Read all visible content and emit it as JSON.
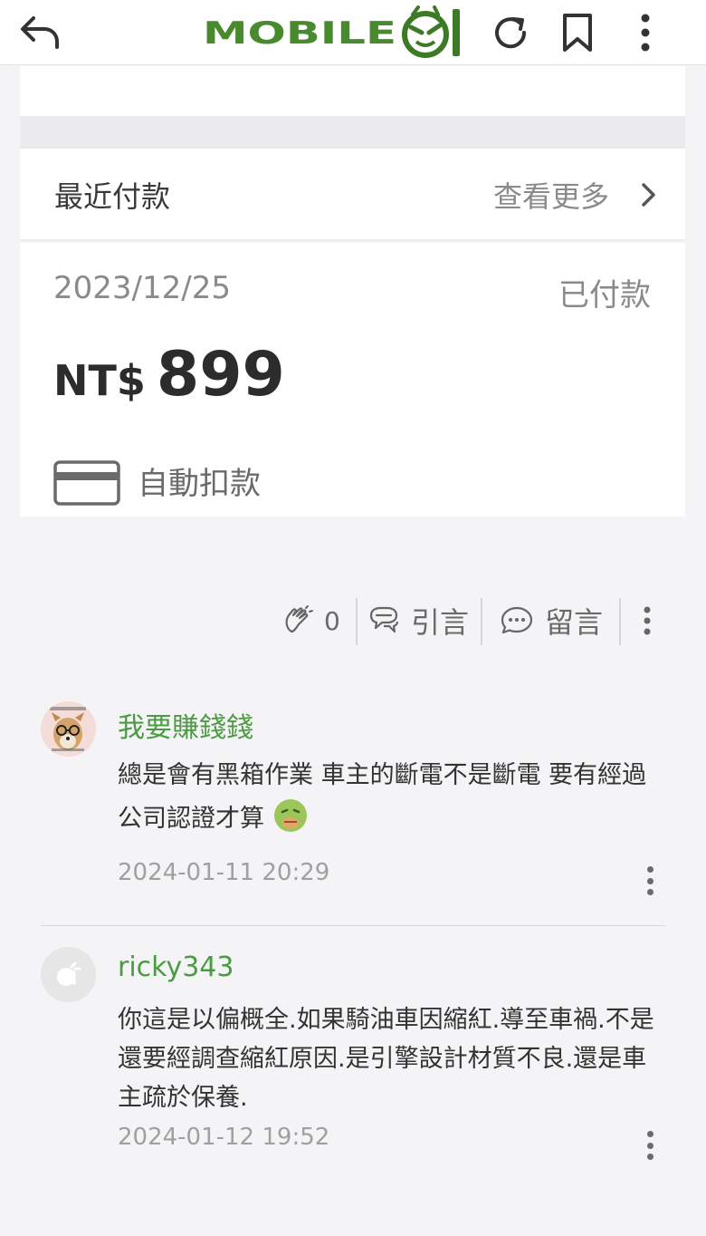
{
  "header": {
    "logo_text": "MOBILE01",
    "back_icon": "reply-arrow-icon",
    "refresh_icon": "refresh-icon",
    "bookmark_icon": "bookmark-icon",
    "menu_icon": "kebab-menu-icon",
    "brand_color": "#4a8a2e"
  },
  "payment_section": {
    "title": "最近付款",
    "more_label": "查看更多",
    "date": "2023/12/25",
    "status": "已付款",
    "currency": "NT$",
    "amount": "899",
    "method": "自動扣款"
  },
  "post_actions": {
    "like_count": "0",
    "quote_label": "引言",
    "comment_label": "留言"
  },
  "comments": [
    {
      "username": "我要賺錢錢",
      "body": "總是會有黑箱作業 車主的斷電不是斷電 要有經過公司認證才算",
      "emoji": "nauseated-face-icon",
      "timestamp": "2024-01-11 20:29"
    },
    {
      "username": "ricky343",
      "body": "你這是以偏概全.如果騎油車因縮紅.導至車禍.不是還要經調查縮紅原因.是引擎設計材質不良.還是車主疏於保養.",
      "timestamp": "2024-01-12 19:52"
    }
  ],
  "colors": {
    "username_green": "#4c9a44",
    "page_bg": "#f4f4f6"
  }
}
